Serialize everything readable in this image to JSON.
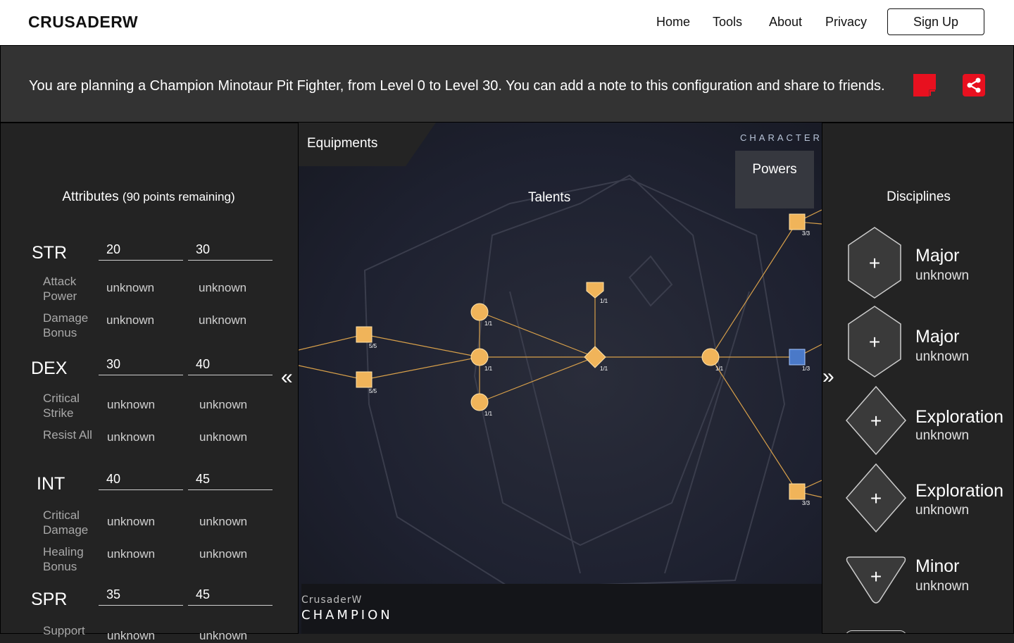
{
  "nav": {
    "brand": "CRUSADERW",
    "links": [
      "Home",
      "Tools",
      "About",
      "Privacy"
    ],
    "signup": "Sign Up"
  },
  "banner": {
    "text": "You are planning a Champion Minotaur Pit Fighter, from Level 0 to Level 30. You can add a note to this configuration and share to friends.",
    "accent_color": "#e8101f"
  },
  "attributes": {
    "title": "Attributes",
    "remaining": "(90 points remaining)",
    "stats": [
      {
        "name": "STR",
        "from": "20",
        "to": "30",
        "subs": [
          {
            "label": "Attack Power",
            "a": "unknown",
            "b": "unknown"
          },
          {
            "label": "Damage Bonus",
            "a": "unknown",
            "b": "unknown"
          }
        ]
      },
      {
        "name": "DEX",
        "from": "30",
        "to": "40",
        "subs": [
          {
            "label": "Critical Strike",
            "a": "unknown",
            "b": "unknown"
          },
          {
            "label": "Resist All",
            "a": "unknown",
            "b": "unknown"
          }
        ]
      },
      {
        "name": "INT",
        "from": "40",
        "to": "45",
        "subs": [
          {
            "label": "Critical Damage",
            "a": "unknown",
            "b": "unknown"
          },
          {
            "label": "Healing Bonus",
            "a": "unknown",
            "b": "unknown"
          }
        ]
      },
      {
        "name": "SPR",
        "from": "35",
        "to": "45",
        "subs": [
          {
            "label": "Support",
            "a": "unknown",
            "b": "unknown"
          }
        ]
      }
    ]
  },
  "center": {
    "tab_equipments": "Equipments",
    "character_label": "CHARACTER",
    "tab_powers": "Powers",
    "talents_title": "Talents",
    "prev_arrow": "«",
    "next_arrow": "»",
    "footer_user": "CrusaderW",
    "footer_class": "CHAMPION",
    "nodes": [
      {
        "rank": "5/5"
      },
      {
        "rank": "5/5"
      },
      {
        "rank": "1/1"
      },
      {
        "rank": "1/1"
      },
      {
        "rank": "1/1"
      },
      {
        "rank": "1/1"
      },
      {
        "rank": "1/1"
      },
      {
        "rank": "1/1"
      },
      {
        "rank": "3/3"
      },
      {
        "rank": "1/3"
      },
      {
        "rank": "3/3"
      }
    ]
  },
  "disciplines": {
    "title": "Disciplines",
    "slots": [
      {
        "type": "Major",
        "value": "unknown",
        "shape": "hexagon"
      },
      {
        "type": "Major",
        "value": "unknown",
        "shape": "hexagon"
      },
      {
        "type": "Exploration",
        "value": "unknown",
        "shape": "diamond"
      },
      {
        "type": "Exploration",
        "value": "unknown",
        "shape": "diamond"
      },
      {
        "type": "Minor",
        "value": "unknown",
        "shape": "triangle"
      }
    ],
    "add_symbol": "+"
  }
}
